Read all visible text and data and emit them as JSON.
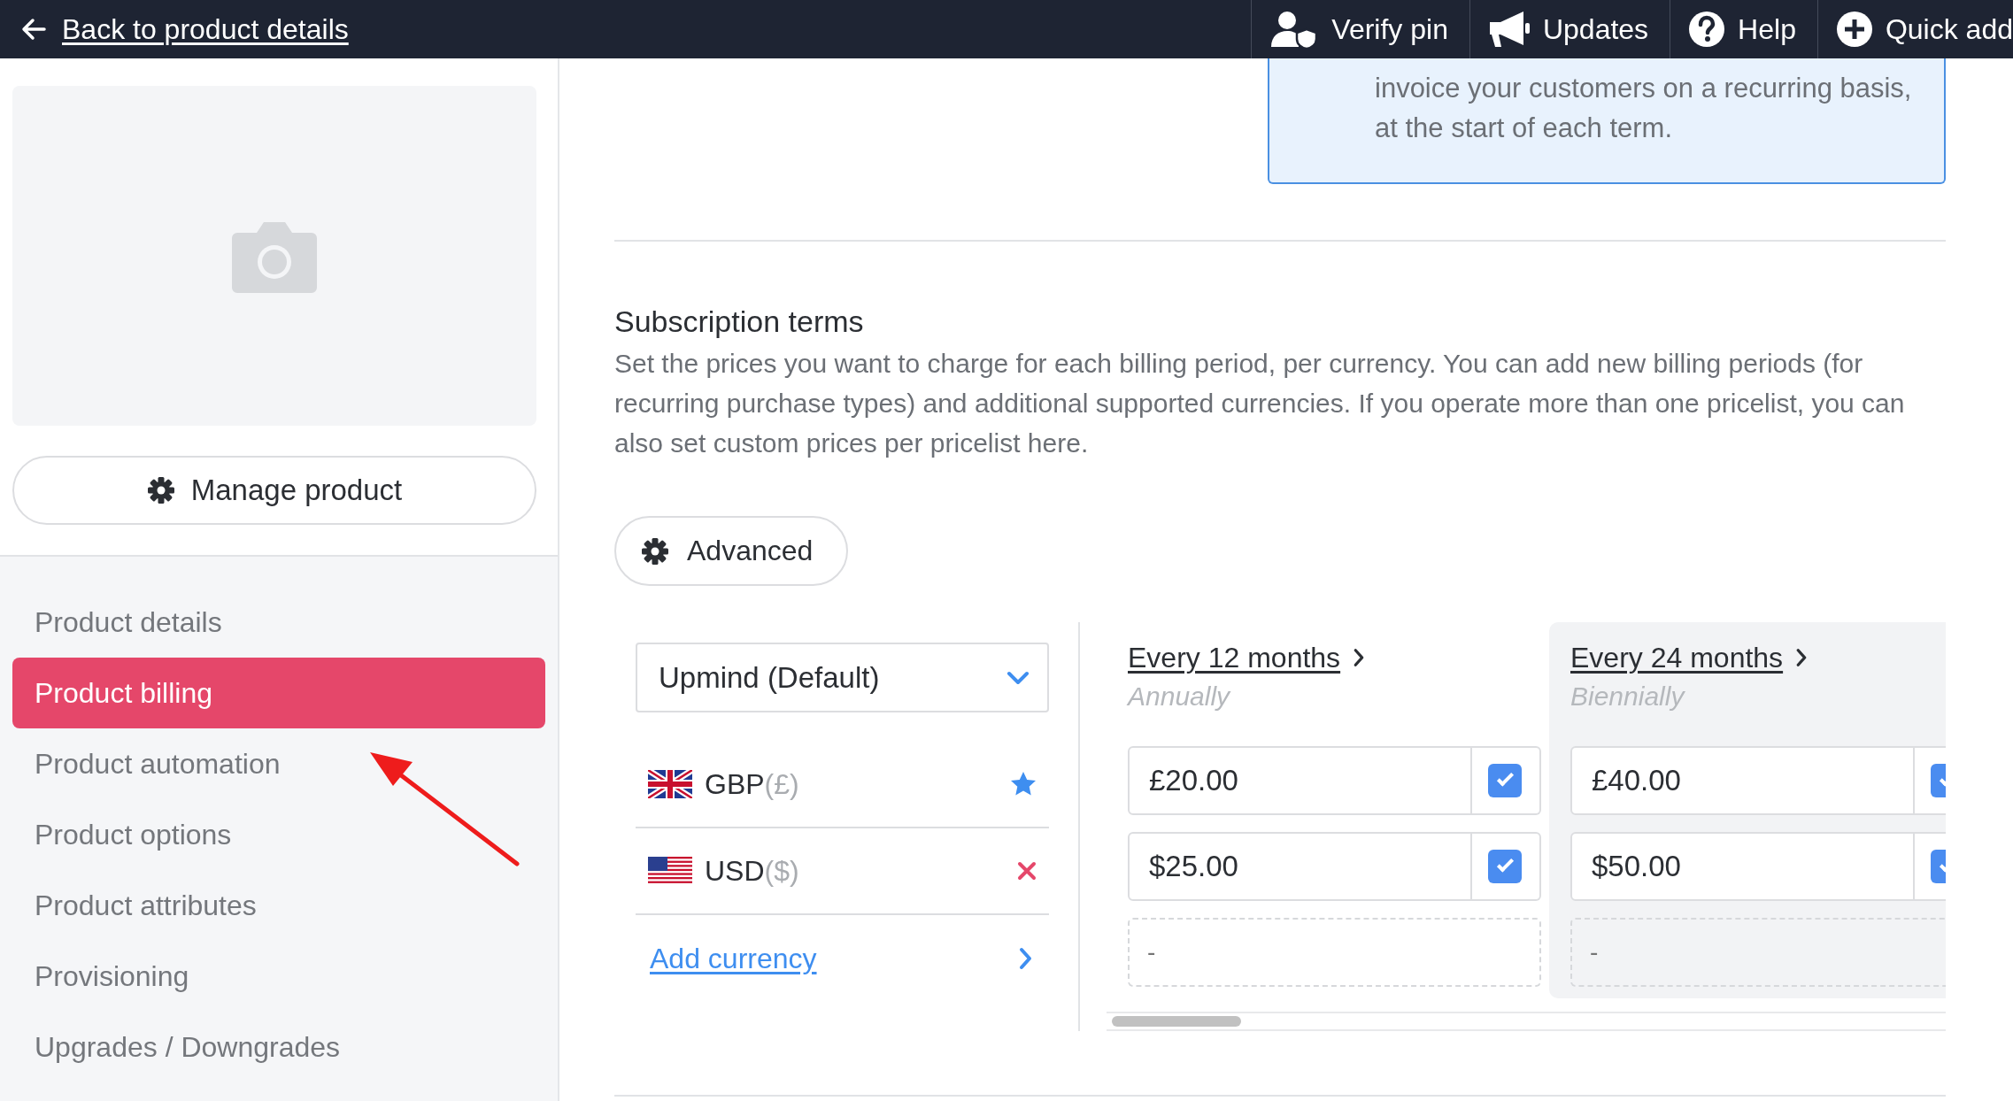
{
  "top_bar": {
    "back_link": "Back to product details",
    "actions": [
      {
        "label": "Verify pin"
      },
      {
        "label": "Updates"
      },
      {
        "label": "Help"
      },
      {
        "label": "Quick add"
      }
    ]
  },
  "sidebar": {
    "manage_button": "Manage product",
    "items": [
      {
        "label": "Product details",
        "selected": false
      },
      {
        "label": "Product billing",
        "selected": true
      },
      {
        "label": "Product automation",
        "selected": false
      },
      {
        "label": "Product options",
        "selected": false
      },
      {
        "label": "Product attributes",
        "selected": false
      },
      {
        "label": "Provisioning",
        "selected": false
      },
      {
        "label": "Upgrades / Downgrades",
        "selected": false
      }
    ]
  },
  "info_box": {
    "text": "invoice your customers on a recurring basis,\nat the start of each term."
  },
  "subscription_terms": {
    "title": "Subscription terms",
    "description": "Set the prices you want to charge for each billing period, per currency. You can add new billing periods (for recurring purchase types) and additional supported currencies. If you operate more than one pricelist, you can also set custom prices per pricelist here.",
    "advanced_button": "Advanced"
  },
  "pricing": {
    "pricelist": "Upmind (Default)",
    "currencies": [
      {
        "code": "GBP",
        "symbol": "(£)"
      },
      {
        "code": "USD",
        "symbol": "($)"
      }
    ],
    "add_currency": "Add currency",
    "periods": [
      {
        "title": "Every 12 months",
        "subtitle": "Annually",
        "highlighted": false,
        "prices": [
          {
            "value": "£20.00",
            "checked": true
          },
          {
            "value": "$25.00",
            "checked": true
          }
        ],
        "empty_placeholder": "-"
      },
      {
        "title": "Every 24 months",
        "subtitle": "Biennially",
        "highlighted": true,
        "prices": [
          {
            "value": "£40.00",
            "checked": true
          },
          {
            "value": "$50.00",
            "checked": true
          }
        ],
        "empty_placeholder": "-"
      }
    ]
  }
}
